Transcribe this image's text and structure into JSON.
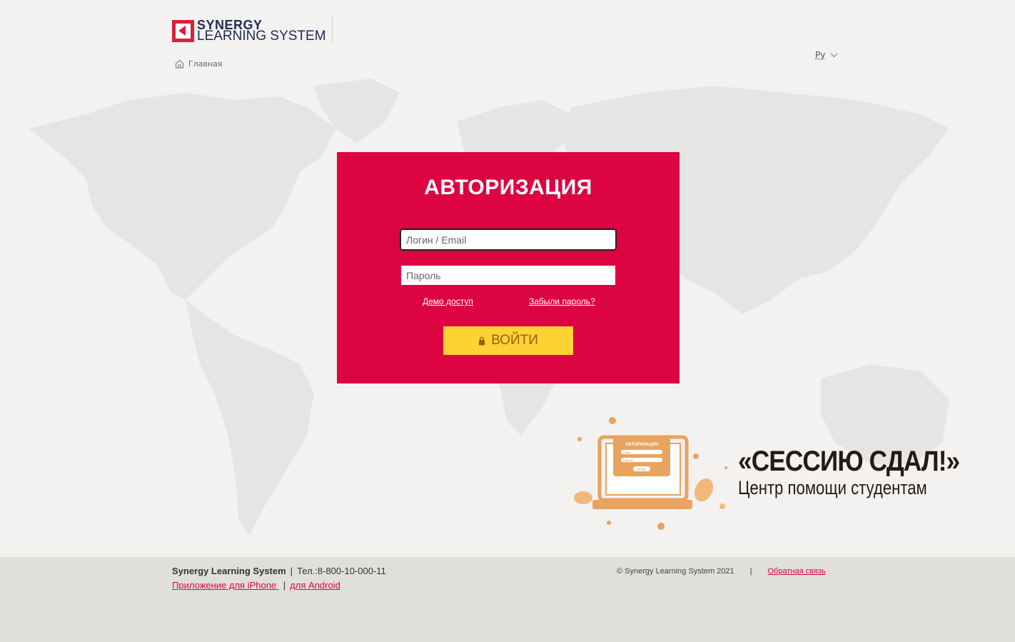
{
  "header": {
    "logo_line1": "SYNERGY",
    "logo_line2": "LEARNING SYSTEM",
    "language": "Ру"
  },
  "breadcrumb": {
    "home_label": "Главная"
  },
  "auth": {
    "title": "АВТОРИЗАЦИЯ",
    "login_placeholder": "Логин / Email",
    "password_placeholder": "Пароль",
    "demo_link": "Демо доступ",
    "forgot_link": "Забыли пароль?",
    "login_button": "ВОЙТИ"
  },
  "promo": {
    "title": "«СЕССИЮ СДАЛ!»",
    "subtitle": "Центр помощи студентам",
    "laptop_title": "АВТОРИЗАЦИЯ",
    "laptop_field1": "Логин",
    "laptop_field2": "Пароль",
    "laptop_button": "ВХОД"
  },
  "footer": {
    "company": "Synergy Learning System",
    "phone": "Тел.:8-800-10-000-11",
    "iphone_link": "Приложение для iPhone ",
    "android_link": "для Android",
    "copyright": "© Synergy Learning System 2021",
    "feedback_link": "Обратная связь"
  },
  "colors": {
    "brand_red": "#dc0541",
    "button_yellow": "#fdd234",
    "background": "#f3f2f1",
    "footer_bg": "#e0dfdc"
  }
}
